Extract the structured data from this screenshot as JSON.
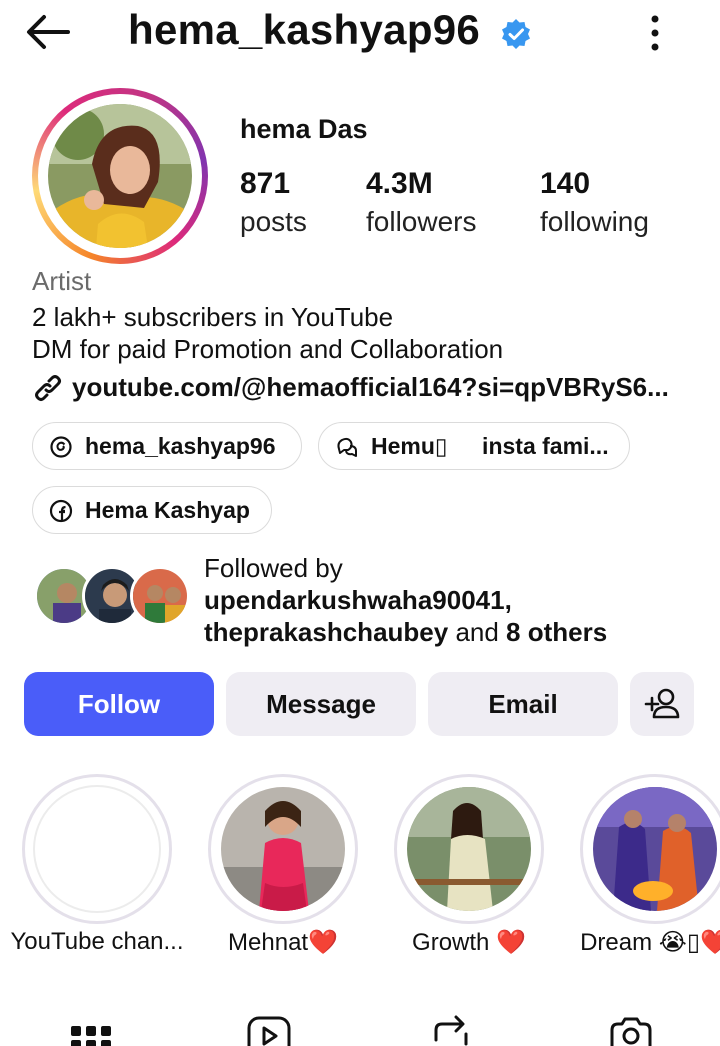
{
  "header": {
    "username": "hema_kashyap96",
    "icons": [
      "back-arrow-icon",
      "verified-badge-icon",
      "more-options-icon"
    ]
  },
  "profile": {
    "full_name": "hema Das",
    "stats": [
      {
        "value": "871",
        "label": "posts"
      },
      {
        "value": "4.3M",
        "label": "followers"
      },
      {
        "value": "140",
        "label": "following"
      }
    ],
    "category": "Artist",
    "bio_lines": [
      "2 lakh+ subscribers in YouTube",
      "DM for paid Promotion and Collaboration"
    ],
    "link": "youtube.com/@hemaofficial164?si=qpVBRyS6..."
  },
  "chips": [
    {
      "icon": "threads-icon",
      "label": "hema_kashyap96"
    },
    {
      "icon": "community-chat-icon",
      "label": "Hemu▯   insta fami..."
    },
    {
      "icon": "facebook-icon",
      "label": "Hema Kashyap"
    }
  ],
  "followed_by": {
    "prefix": "Followed by",
    "user1": "upendarkushwaha90041,",
    "user2": "theprakashchaubey",
    "and_text": " and ",
    "others": "8 others"
  },
  "actions": {
    "follow": "Follow",
    "message": "Message",
    "email": "Email",
    "add_icon": "add-person-icon"
  },
  "highlights": [
    {
      "caption": "YouTube chan..."
    },
    {
      "caption": "Mehnat❤️"
    },
    {
      "caption": "Growth ❤️"
    },
    {
      "caption": "Dream 😭▯❤️"
    }
  ],
  "tabs": [
    "grid-icon",
    "reels-icon",
    "reposts-icon",
    "tagged-icon"
  ],
  "colors": {
    "accent_blue": "#4a5df9",
    "verified_blue": "#3897f0",
    "button_gray": "#efedf3",
    "muted_text": "#6b6b6b"
  }
}
